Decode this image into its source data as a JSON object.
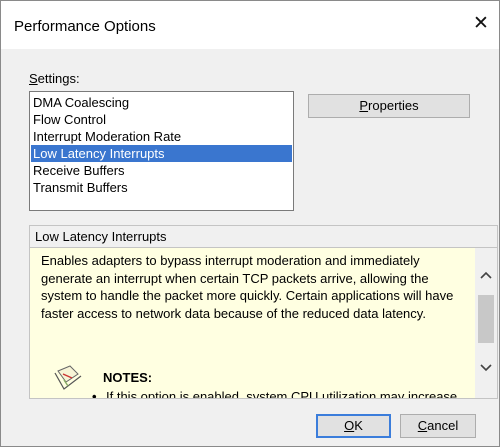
{
  "window": {
    "title": "Performance Options",
    "close_glyph": "✕"
  },
  "settings": {
    "label_prefix": "",
    "label_mnemonic": "S",
    "label_rest": "ettings:",
    "items": [
      {
        "label": "DMA Coalescing",
        "selected": false
      },
      {
        "label": "Flow Control",
        "selected": false
      },
      {
        "label": "Interrupt Moderation Rate",
        "selected": false
      },
      {
        "label": "Low Latency Interrupts",
        "selected": true
      },
      {
        "label": "Receive Buffers",
        "selected": false
      },
      {
        "label": "Transmit Buffers",
        "selected": false
      }
    ]
  },
  "buttons": {
    "properties": {
      "mnemonic": "P",
      "rest": "roperties"
    },
    "ok": {
      "mnemonic": "O",
      "rest": "K"
    },
    "cancel": {
      "mnemonic": "C",
      "rest": "ancel"
    }
  },
  "description": {
    "header": "Low Latency Interrupts",
    "text": "Enables adapters to bypass interrupt moderation and immediately generate an interrupt when certain TCP packets arrive, allowing the system to handle the packet more quickly. Certain applications will have faster access to network data because of the reduced data latency.",
    "notes_label": "NOTES:",
    "bullet": "If this option is enabled, system CPU utilization may increase."
  },
  "colors": {
    "selection": "#3a76cf",
    "description_bg": "#ffffe1",
    "default_button_border": "#3b7ddb"
  },
  "icons": {
    "notes": "notes-pencil-icon",
    "scroll_up": "chevron-up-icon",
    "scroll_down": "chevron-down-icon"
  }
}
